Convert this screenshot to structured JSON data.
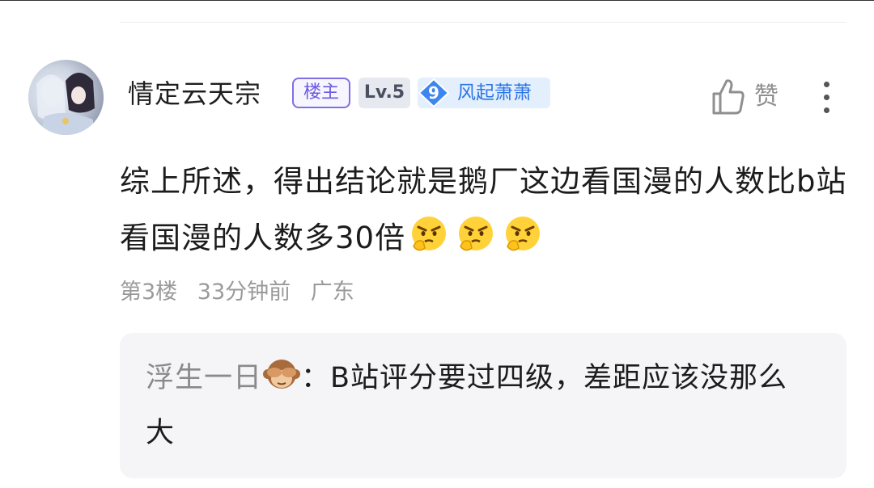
{
  "comment": {
    "username": "情定云天宗",
    "owner_badge": "楼主",
    "level_badge": "Lv.5",
    "fan_badge": {
      "level": "9",
      "name": "风起萧萧"
    },
    "like_label": "赞",
    "content": "综上所述，得出结论就是鹅厂这边看国漫的人数比b站看国漫的人数多30倍",
    "emojis": [
      "angry-thinking-emoji",
      "angry-thinking-emoji",
      "angry-thinking-emoji"
    ],
    "floor": "第3楼",
    "time": "33分钟前",
    "location": "广东"
  },
  "reply": {
    "name": "浮生一日",
    "name_emoji": "see-no-evil-monkey-emoji",
    "separator": "：",
    "text": "B站评分要过四级，差距应该没那么大"
  },
  "colors": {
    "owner_badge": "#6b5ae0",
    "fan_badge_text": "#2b74e6",
    "fan_badge_bg": "#e3effd",
    "meta_text": "#9a9a9a",
    "reply_bg": "#f5f5f7"
  }
}
